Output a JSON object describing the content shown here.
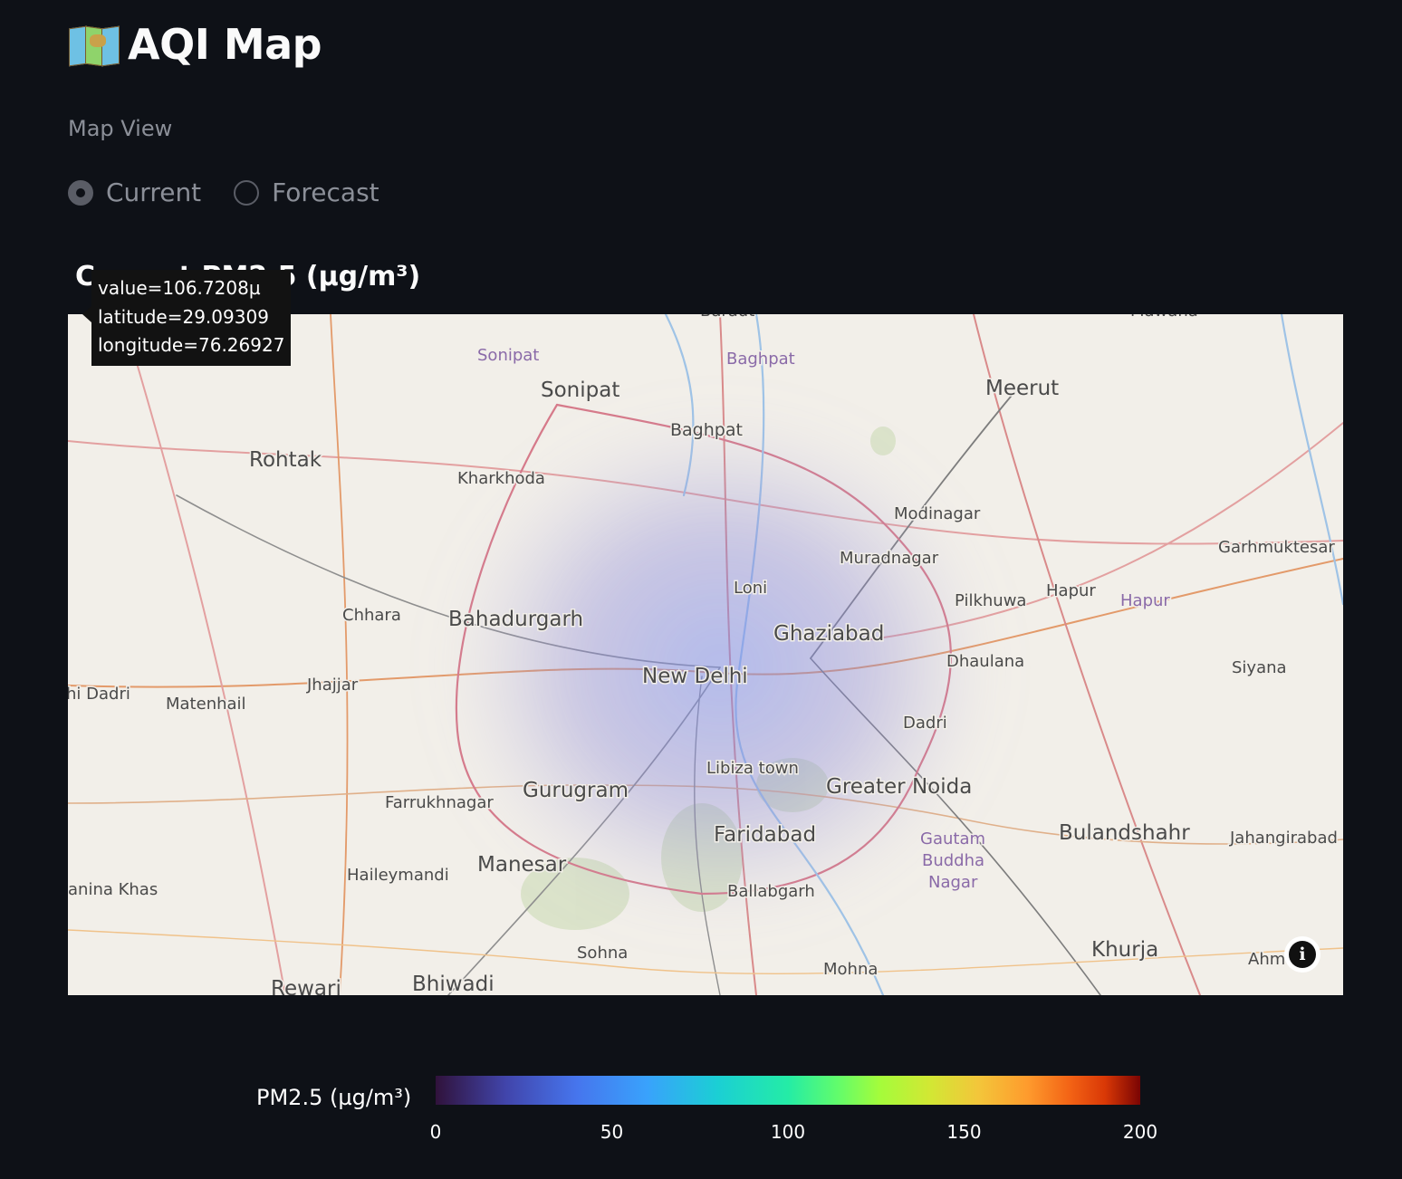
{
  "app": {
    "title": "AQI Map",
    "title_icon": "world-map-icon"
  },
  "controls": {
    "map_view_label": "Map View",
    "options": [
      {
        "label": "Current",
        "selected": true
      },
      {
        "label": "Forecast",
        "selected": false
      }
    ]
  },
  "chart": {
    "title": "Current PM2.5 (µg/m³)"
  },
  "tooltip": {
    "lines": [
      "value=106.7208µ",
      "latitude=29.09309",
      "longitude=76.26927"
    ]
  },
  "map": {
    "places": [
      {
        "name": "Sonipat",
        "size": "large"
      },
      {
        "name": "Sonipat",
        "size": "admin"
      },
      {
        "name": "Baghpat",
        "size": "admin"
      },
      {
        "name": "Baghpat",
        "size": "medium"
      },
      {
        "name": "Meerut",
        "size": "large"
      },
      {
        "name": "Rohtak",
        "size": "large"
      },
      {
        "name": "Kharkhoda",
        "size": "small"
      },
      {
        "name": "Modinagar",
        "size": "small"
      },
      {
        "name": "Muradnagar",
        "size": "small"
      },
      {
        "name": "Garhmuktesar",
        "size": "small"
      },
      {
        "name": "Loni",
        "size": "small"
      },
      {
        "name": "Pilkhuwa",
        "size": "small"
      },
      {
        "name": "Hapur",
        "size": "small"
      },
      {
        "name": "Hapur",
        "size": "admin"
      },
      {
        "name": "Chhara",
        "size": "small"
      },
      {
        "name": "Bahadurgarh",
        "size": "large"
      },
      {
        "name": "Ghaziabad",
        "size": "large"
      },
      {
        "name": "Jhajjar",
        "size": "small"
      },
      {
        "name": "Dhaulana",
        "size": "small"
      },
      {
        "name": "New Delhi",
        "size": "large"
      },
      {
        "name": "Siyana",
        "size": "small"
      },
      {
        "name": "hi Dadri",
        "size": "small"
      },
      {
        "name": "Matenhail",
        "size": "small"
      },
      {
        "name": "Dadri",
        "size": "small"
      },
      {
        "name": "Libiza town",
        "size": "small"
      },
      {
        "name": "Greater Noida",
        "size": "large"
      },
      {
        "name": "Farrukhnagar",
        "size": "small"
      },
      {
        "name": "Gurugram",
        "size": "large"
      },
      {
        "name": "Faridabad",
        "size": "large"
      },
      {
        "name": "Gautam",
        "size": "admin"
      },
      {
        "name": "Buddha",
        "size": "admin"
      },
      {
        "name": "Nagar",
        "size": "admin"
      },
      {
        "name": "Bulandshahr",
        "size": "large"
      },
      {
        "name": "Jahangirabad",
        "size": "small"
      },
      {
        "name": "Haileymandi",
        "size": "small"
      },
      {
        "name": "Manesar",
        "size": "large"
      },
      {
        "name": "anina Khas",
        "size": "small"
      },
      {
        "name": "Ballabgarh",
        "size": "small"
      },
      {
        "name": "Khurja",
        "size": "large"
      },
      {
        "name": "Sohna",
        "size": "small"
      },
      {
        "name": "Mohna",
        "size": "small"
      },
      {
        "name": "Ahm",
        "size": "small"
      },
      {
        "name": "Rewari",
        "size": "large"
      },
      {
        "name": "Bhiwadi",
        "size": "large"
      },
      {
        "name": "Baraut",
        "size": "small"
      },
      {
        "name": "Mawana",
        "size": "small"
      }
    ],
    "heat_color": "#7a7ad8"
  },
  "colorbar": {
    "title": "PM2.5 (µg/m³)",
    "ticks": [
      "0",
      "50",
      "100",
      "150",
      "200"
    ],
    "tick_values": [
      0,
      50,
      100,
      150,
      200
    ],
    "range": [
      0,
      200
    ],
    "colormap": "turbo"
  }
}
